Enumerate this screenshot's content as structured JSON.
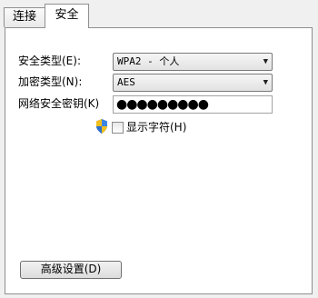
{
  "tabs": [
    {
      "label": "连接",
      "active": false
    },
    {
      "label": "安全",
      "active": true
    }
  ],
  "security": {
    "security_type_label": "安全类型(E):",
    "security_type_value": "WPA2 - 个人",
    "encryption_type_label": "加密类型(N):",
    "encryption_type_value": "AES",
    "network_key_label": "网络安全密钥(K)",
    "network_key_value": "●●●●●●●●●",
    "show_characters_label": "显示字符(H)",
    "show_characters_checked": false
  },
  "advanced_button_label": "高级设置(D)",
  "colors": {
    "panel_bg": "#ffffff",
    "window_bg": "#f0f0f0",
    "border": "#8e8f8f"
  }
}
